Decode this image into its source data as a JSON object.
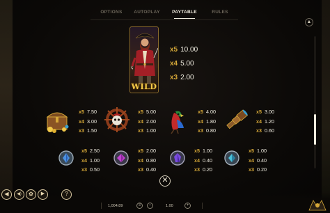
{
  "tabs": [
    {
      "label": "OPTIONS",
      "active": false
    },
    {
      "label": "AUTOPLAY",
      "active": false
    },
    {
      "label": "PAYTABLE",
      "active": true
    },
    {
      "label": "RULES",
      "active": false
    }
  ],
  "wild": {
    "label": "WILD",
    "pays": [
      {
        "mult": "x5",
        "value": "10.00"
      },
      {
        "mult": "x4",
        "value": "5.00"
      },
      {
        "mult": "x3",
        "value": "2.00"
      }
    ]
  },
  "symbols": [
    {
      "icon": "treasure-chest-icon",
      "pays": [
        {
          "mult": "x5",
          "value": "7.50"
        },
        {
          "mult": "x4",
          "value": "3.00"
        },
        {
          "mult": "x3",
          "value": "1.50"
        }
      ]
    },
    {
      "icon": "skull-wheel-icon",
      "pays": [
        {
          "mult": "x5",
          "value": "5.00"
        },
        {
          "mult": "x4",
          "value": "2.00"
        },
        {
          "mult": "x3",
          "value": "1.00"
        }
      ]
    },
    {
      "icon": "parrot-icon",
      "pays": [
        {
          "mult": "x5",
          "value": "4.00"
        },
        {
          "mult": "x4",
          "value": "1.80"
        },
        {
          "mult": "x3",
          "value": "0.80"
        }
      ]
    },
    {
      "icon": "spyglass-icon",
      "pays": [
        {
          "mult": "x5",
          "value": "3.00"
        },
        {
          "mult": "x4",
          "value": "1.20"
        },
        {
          "mult": "x3",
          "value": "0.60"
        }
      ]
    },
    {
      "icon": "blue-gem-coin-icon",
      "pays": [
        {
          "mult": "x5",
          "value": "2.50"
        },
        {
          "mult": "x4",
          "value": "1.00"
        },
        {
          "mult": "x3",
          "value": "0.50"
        }
      ]
    },
    {
      "icon": "purple-gem-coin-icon",
      "pays": [
        {
          "mult": "x5",
          "value": "2.00"
        },
        {
          "mult": "x4",
          "value": "0.80"
        },
        {
          "mult": "x3",
          "value": "0.40"
        }
      ]
    },
    {
      "icon": "violet-gem-coin-icon",
      "pays": [
        {
          "mult": "x5",
          "value": "1.00"
        },
        {
          "mult": "x4",
          "value": "0.40"
        },
        {
          "mult": "x3",
          "value": "0.20"
        }
      ]
    },
    {
      "icon": "cyan-gem-coin-icon",
      "pays": [
        {
          "mult": "x5",
          "value": "1.00"
        },
        {
          "mult": "x4",
          "value": "0.40"
        },
        {
          "mult": "x3",
          "value": "0.20"
        }
      ]
    }
  ],
  "close_symbol": "✕",
  "bottom": {
    "balance": "1,004.89",
    "bet": "1.00",
    "buttons": [
      {
        "icon": "back-arrow-icon",
        "glyph": "◀"
      },
      {
        "icon": "sound-icon",
        "glyph": "◀)"
      },
      {
        "icon": "settings-gear-icon",
        "glyph": "✿"
      },
      {
        "icon": "info-play-icon",
        "glyph": "▶"
      },
      {
        "icon": "help-icon",
        "glyph": "?"
      }
    ]
  },
  "colors": {
    "accent_gold": "#d6a838",
    "wild_gold": "#f2c94a",
    "text_light": "#f3efe3",
    "tab_inactive": "#6c665a"
  }
}
